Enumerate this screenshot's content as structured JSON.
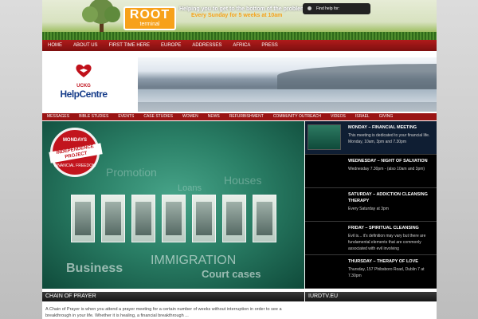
{
  "banner": {
    "logo_main": "ROOT",
    "logo_sub": "terminal",
    "tagline": "Helping you to get to the bottom of the problem.",
    "schedule": "Every Sunday for 5 weeks at 10am",
    "help_label": "Find help for:"
  },
  "nav": [
    "HOME",
    "ABOUT US",
    "FIRST TIME HERE",
    "EUROPE",
    "ADDRESSES",
    "AFRICA",
    "PRESS"
  ],
  "brand": {
    "org": "UCKG",
    "name": "HelpCentre"
  },
  "subnav": [
    "MESSAGES",
    "BIBLE STUDIES",
    "EVENTS",
    "CASE STUDIES",
    "WOMEN",
    "NEWS",
    "REFURBISHMENT",
    "COMMUNITY OUTREACH",
    "VIDEOS",
    "ISRAEL",
    "GIVING"
  ],
  "hero": {
    "badge_top": "MONDAYS",
    "badge_main": "INDEPENDENCE PROJECT",
    "badge_sub": "FINANCIAL FREEDOM",
    "words": [
      "Promotion",
      "Houses",
      "Loans",
      "Business",
      "IMMIGRATION",
      "Court cases"
    ]
  },
  "events": [
    {
      "title": "MONDAY – FINANCIAL MEETING",
      "text": "This meeting is dedicated to your financial life. Monday, 10am, 3pm and 7.30pm"
    },
    {
      "title": "WEDNESDAY – NIGHT OF SALVATION",
      "text": "Wednesday 7.30pm - (also 10am and 3pm)"
    },
    {
      "title": "SATURDAY – ADDICTION CLEANSING THERAPY",
      "text": "Every Saturday at 3pm"
    },
    {
      "title": "FRIDAY – SPIRITUAL CLEANSING",
      "text": "Evil is... it's definition may vary but there are fundamental elements that are commonly associated with evil involving"
    },
    {
      "title": "THURSDAY – THERAPY OF LOVE",
      "text": "Thursday, 157 Phibsboro Road, Dublin 7 at 7.30pm"
    }
  ],
  "sections": {
    "chain_title": "CHAIN OF PRAYER",
    "chain_text": "A Chain of Prayer is when you attend a prayer meeting for a certain number of weeks without interruption in order to see a breakthrough in your life. Whether it is healing, a financial breakthrough ...",
    "tv_title": "IURDTV.EU"
  },
  "colors": {
    "nav_red": "#9a1414",
    "accent_orange": "#f6a21a",
    "brand_blue": "#173d8a"
  }
}
